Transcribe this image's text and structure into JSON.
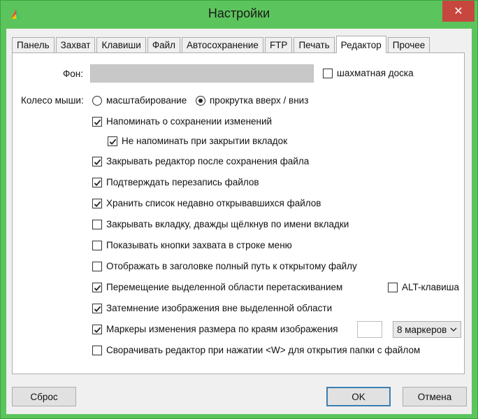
{
  "window": {
    "title": "Настройки",
    "close_glyph": "✕",
    "accent_color": "#5cc45c"
  },
  "tabs": [
    {
      "label": "Панель"
    },
    {
      "label": "Захват"
    },
    {
      "label": "Клавиши"
    },
    {
      "label": "Файл"
    },
    {
      "label": "Автосохранение"
    },
    {
      "label": "FTP"
    },
    {
      "label": "Печать"
    },
    {
      "label": "Редактор",
      "active": true
    },
    {
      "label": "Прочее"
    }
  ],
  "editor": {
    "background_label": "Фон:",
    "background_value": "",
    "checkerboard_label": "шахматная доска",
    "checkerboard_checked": false,
    "mouse_wheel_label": "Колесо мыши:",
    "wheel_options": [
      {
        "label": "масштабирование",
        "selected": false
      },
      {
        "label": "прокрутка вверх / вниз",
        "selected": true
      }
    ],
    "options": [
      {
        "label": "Напоминать о сохранении изменений",
        "checked": true
      },
      {
        "label": "Не напоминать при закрытии вкладок",
        "checked": true
      },
      {
        "label": "Закрывать редактор после сохранения файла",
        "checked": true
      },
      {
        "label": "Подтверждать перезапись файлов",
        "checked": true
      },
      {
        "label": "Хранить список недавно открывавшихся файлов",
        "checked": true
      },
      {
        "label": "Закрывать вкладку, дважды щёлкнув по имени вкладки",
        "checked": false
      },
      {
        "label": "Показывать кнопки захвата в строке меню",
        "checked": false
      },
      {
        "label": "Отображать в заголовке полный путь к открытому файлу",
        "checked": false
      },
      {
        "label": "Перемещение выделенной области перетаскиванием",
        "checked": true
      },
      {
        "label": "Затемнение изображения вне выделенной области",
        "checked": true
      },
      {
        "label": "Маркеры изменения размера по краям изображения",
        "checked": true
      },
      {
        "label": "Сворачивать редактор при нажатии <W> для открытия папки с файлом",
        "checked": false
      }
    ],
    "alt_key_label": "ALT-клавиша",
    "alt_key_checked": false,
    "marker_size_value": "",
    "marker_count_selected": "8 маркеров"
  },
  "buttons": {
    "reset": "Сброс",
    "ok": "OK",
    "cancel": "Отмена"
  }
}
